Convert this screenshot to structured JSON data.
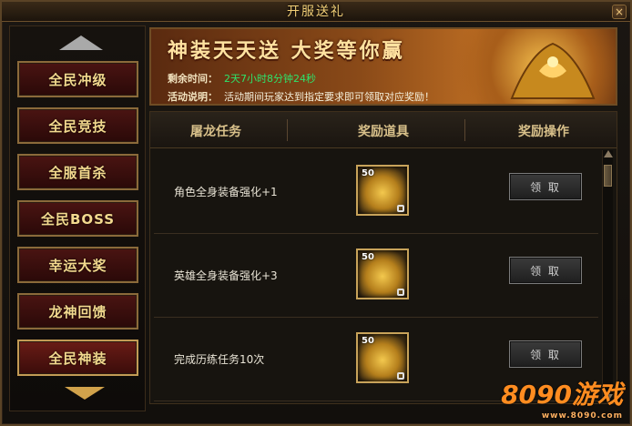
{
  "window": {
    "title": "开服送礼",
    "close_glyph": "×"
  },
  "menu": [
    {
      "label": "全民冲级"
    },
    {
      "label": "全民竞技"
    },
    {
      "label": "全服首杀"
    },
    {
      "label": "全民BOSS"
    },
    {
      "label": "幸运大奖"
    },
    {
      "label": "龙神回馈"
    },
    {
      "label": "全民神装",
      "active": true
    }
  ],
  "banner": {
    "title": "神装天天送 大奖等你赢",
    "time_label": "剩余时间：",
    "time_value": "2天7小时8分钟24秒",
    "desc_label": "活动说明：",
    "desc_value": "活动期间玩家达到指定要求即可领取对应奖励！"
  },
  "table": {
    "headers": [
      "屠龙任务",
      "奖励道具",
      "奖励操作"
    ],
    "rows": [
      {
        "task": "角色全身装备强化+1",
        "item_count": "50",
        "button": "领 取"
      },
      {
        "task": "英雄全身装备强化+3",
        "item_count": "50",
        "button": "领 取"
      },
      {
        "task": "完成历练任务10次",
        "item_count": "50",
        "button": "领 取"
      }
    ]
  },
  "watermark": {
    "text": "8090游戏",
    "sub": "www.8090.com"
  },
  "colors": {
    "accent": "#f2cf77",
    "time_green": "#2ee36b",
    "menu_red": "#4a1412"
  }
}
